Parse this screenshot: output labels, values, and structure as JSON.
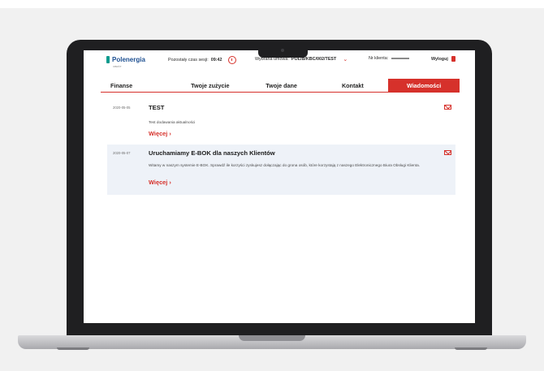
{
  "header": {
    "logo_text": "Polenergia",
    "logo_sub": "OBRÓT",
    "session_label": "Pozostały czas sesji:",
    "session_time": "09:42",
    "ppe_label": "Wybrana umowa:",
    "ppe_value": "POL/B/KBC/002/TEST",
    "client_label": "Nr klienta:",
    "logout_label": "Wyloguj"
  },
  "nav": {
    "items": [
      "Finanse",
      "Twoje zużycie",
      "Twoje dane",
      "Kontakt",
      "Wiadomości"
    ],
    "active": "Wiadomości"
  },
  "messages": [
    {
      "date": "2020-05-05",
      "title": "TEST",
      "body": "Test dodawania aktualności",
      "more": "Więcej  ›"
    },
    {
      "date": "2020-05-07",
      "title": "Uruchamiamy E-BOK dla naszych Klientów",
      "body": "Witamy w naszym systemie E-BOK. Sprawdź ile korzyści zyskujesz dołączając do grona osób, które korzystają z naszego Elektronicznego Biura Obsługi Klienta.",
      "more": "Więcej  ›"
    }
  ],
  "colors": {
    "accent": "#d6312b",
    "brand": "#1d4f91",
    "highlight_row": "#eef2f8"
  }
}
